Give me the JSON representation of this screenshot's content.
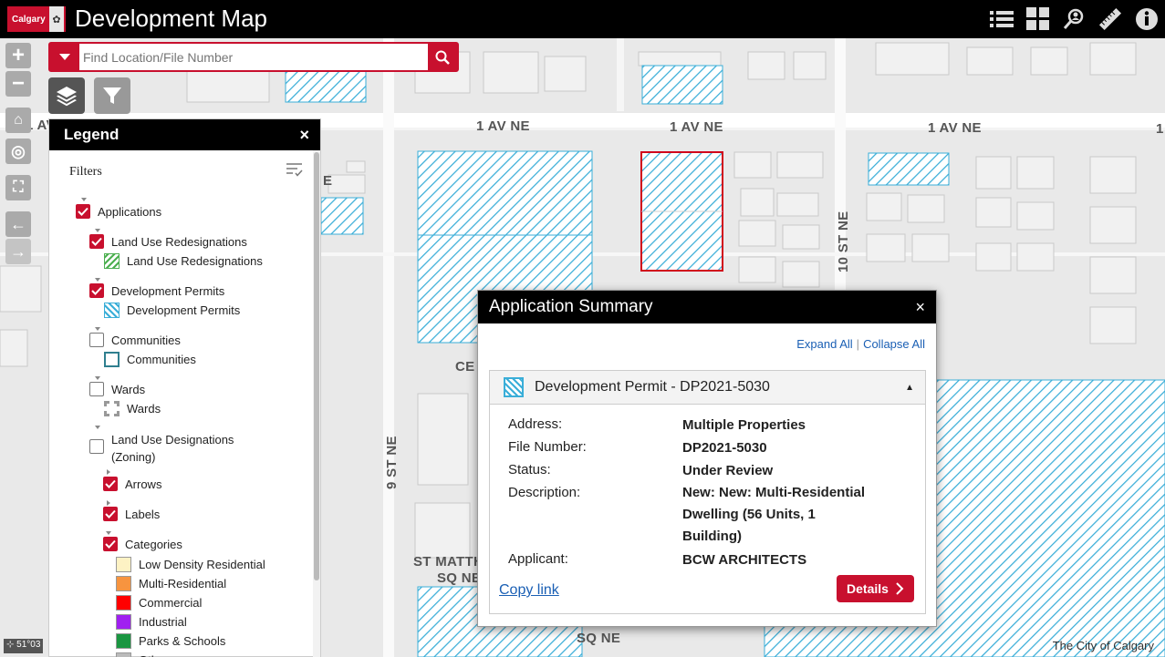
{
  "header": {
    "logo_text": "Calgary",
    "title": "Development Map",
    "buttons": [
      "list-icon",
      "grid-icon",
      "search-person-icon",
      "ruler-icon",
      "info-icon"
    ]
  },
  "search": {
    "placeholder": "Find Location/File Number"
  },
  "map": {
    "street_labels": [
      "1 AV NE",
      "1 AV NE",
      "1 AV NE",
      "1 AV",
      "10 ST NE",
      "9 ST NE",
      "ST MATTH",
      "SQ NE",
      "SQ NE",
      "CE",
      "E",
      "1"
    ],
    "attribution": "The City of Calgary",
    "coords": "51°03"
  },
  "legend": {
    "title": "Legend",
    "close": "×",
    "filters_label": "Filters",
    "items": {
      "applications": "Applications",
      "lur_group": "Land Use Redesignations",
      "lur_item": "Land Use Redesignations",
      "dp_group": "Development Permits",
      "dp_item": "Development Permits",
      "communities_group": "Communities",
      "communities_item": "Communities",
      "wards_group": "Wards",
      "wards_item": "Wards",
      "lud_line1": "Land Use Designations",
      "lud_line2": "(Zoning)",
      "arrows": "Arrows",
      "labels": "Labels",
      "categories": "Categories"
    },
    "categories": [
      {
        "label": "Low Density Residential",
        "color": "#fdf2c4"
      },
      {
        "label": "Multi-Residential",
        "color": "#f7943f"
      },
      {
        "label": "Commercial",
        "color": "#ff0000"
      },
      {
        "label": "Industrial",
        "color": "#a020f0"
      },
      {
        "label": "Parks & Schools",
        "color": "#1a9641"
      },
      {
        "label": "Other",
        "color": "#bbbbbb"
      }
    ]
  },
  "popup": {
    "title": "Application Summary",
    "close": "×",
    "expand_all": "Expand All",
    "sep": "|",
    "collapse_all": "Collapse All",
    "permit_title": "Development Permit - DP2021-5030",
    "fields": {
      "address_k": "Address:",
      "address_v": "Multiple Properties",
      "file_k": "File Number:",
      "file_v": "DP2021-5030",
      "status_k": "Status:",
      "status_v": "Under Review",
      "desc_k": "Description:",
      "desc_v": "New: New: Multi-Residential Dwelling (56 Units, 1 Building)",
      "applicant_k": "Applicant:",
      "applicant_v": "BCW ARCHITECTS"
    },
    "copy_link": "Copy link",
    "details": "Details"
  },
  "colors": {
    "accent": "#c8102e",
    "hatch": "#3aaed8",
    "link": "#1a5fb4"
  }
}
